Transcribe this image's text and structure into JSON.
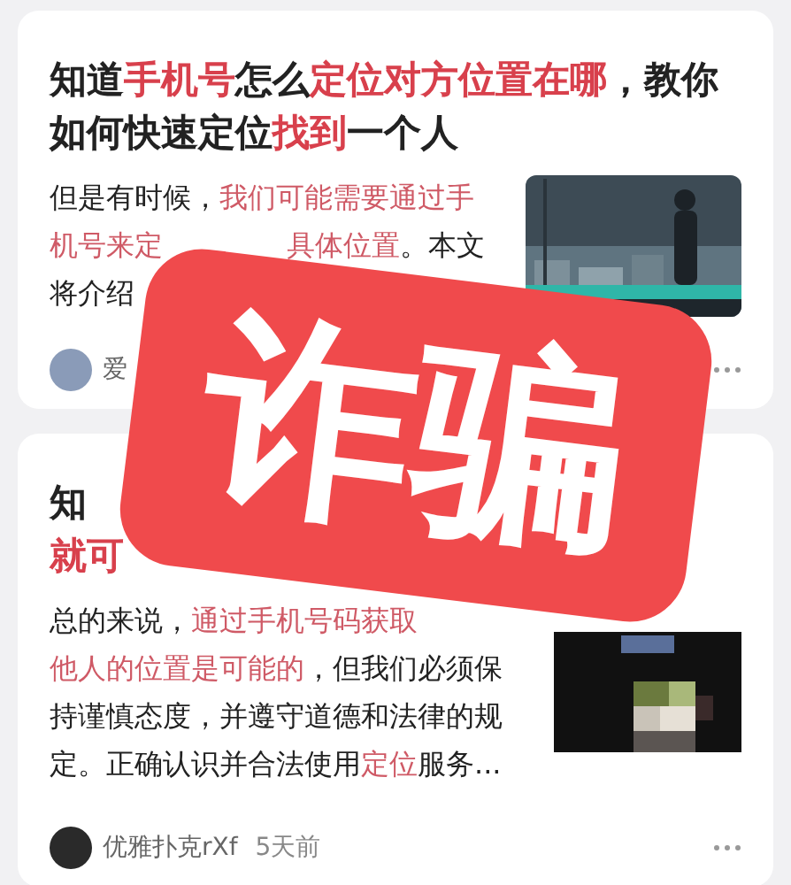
{
  "cards": [
    {
      "title_lines": [
        [
          {
            "text": "知道",
            "highlight": false
          },
          {
            "text": "手机号",
            "highlight": true
          },
          {
            "text": "怎么",
            "highlight": false
          },
          {
            "text": "定位对方位置在哪",
            "highlight": true
          },
          {
            "text": "，教你",
            "highlight": false
          }
        ],
        [
          {
            "text": "如何快速定位",
            "highlight": false
          },
          {
            "text": "找到",
            "highlight": true
          },
          {
            "text": "一个人",
            "highlight": false
          }
        ]
      ],
      "body_lines": [
        [
          [
            {
              "text": "但是有时候，",
              "highlight": false
            },
            {
              "text": "我们可能需要通过手",
              "highlight": true
            }
          ]
        ],
        [
          [
            {
              "text": "机号来定",
              "highlight": true
            }
          ],
          [
            {
              "text": "具体位置",
              "highlight": true
            },
            {
              "text": "。本文",
              "highlight": false
            }
          ]
        ],
        [
          [
            {
              "text": "将介绍",
              "highlight": false
            }
          ]
        ]
      ],
      "thumbnail": {
        "kind": "picture"
      },
      "author": "爱"
    },
    {
      "title_lines": [
        [
          {
            "text": "知",
            "highlight": false
          }
        ],
        [
          {
            "text": "就可",
            "highlight": true
          }
        ]
      ],
      "body_lines": [
        [
          [
            {
              "text": "总的来说，",
              "highlight": false
            },
            {
              "text": "通过手机号码获取",
              "highlight": true
            }
          ]
        ],
        [
          [
            {
              "text": "他人的位置是可能的",
              "highlight": true
            },
            {
              "text": "，但我们必须保",
              "highlight": false
            }
          ]
        ],
        [
          [
            {
              "text": "持谨慎态度，并遵守道德和法律的规",
              "highlight": false
            }
          ]
        ],
        [
          [
            {
              "text": "定。正确认识并合法使用",
              "highlight": false
            },
            {
              "text": "定位",
              "highlight": true
            },
            {
              "text": "服务...",
              "highlight": false
            }
          ]
        ]
      ],
      "thumbnail": {
        "kind": "picture"
      },
      "author": "优雅扑克rXf",
      "time": "5天前"
    }
  ],
  "stamp": {
    "text": "诈骗"
  }
}
